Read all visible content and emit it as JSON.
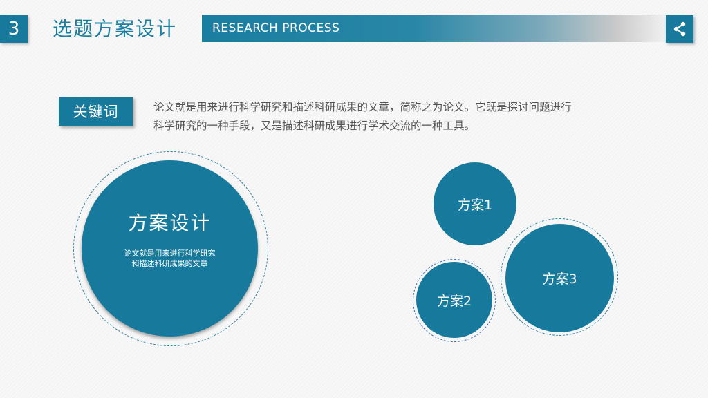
{
  "header": {
    "section_number": "3",
    "section_title": "选题方案设计",
    "banner_text": "RESEARCH PROCESS",
    "share_icon": "share-icon"
  },
  "keyword": {
    "label": "关键词",
    "description_line1": "论文就是用来进行科学研究和描述科研成果的文章，简称之为论文。它既是探讨问题进行",
    "description_line2": "科学研究的一种手段，又是描述科研成果进行学术交流的一种工具。"
  },
  "main_circle": {
    "title": "方案设计",
    "desc_line1": "论文就是用来进行科学研究",
    "desc_line2": "和描述科研成果的文章"
  },
  "options": [
    {
      "label": "方案1"
    },
    {
      "label": "方案2"
    },
    {
      "label": "方案3"
    }
  ],
  "colors": {
    "accent": "#177a9c",
    "text_gray": "#555555",
    "background": "#f7f7f7"
  }
}
